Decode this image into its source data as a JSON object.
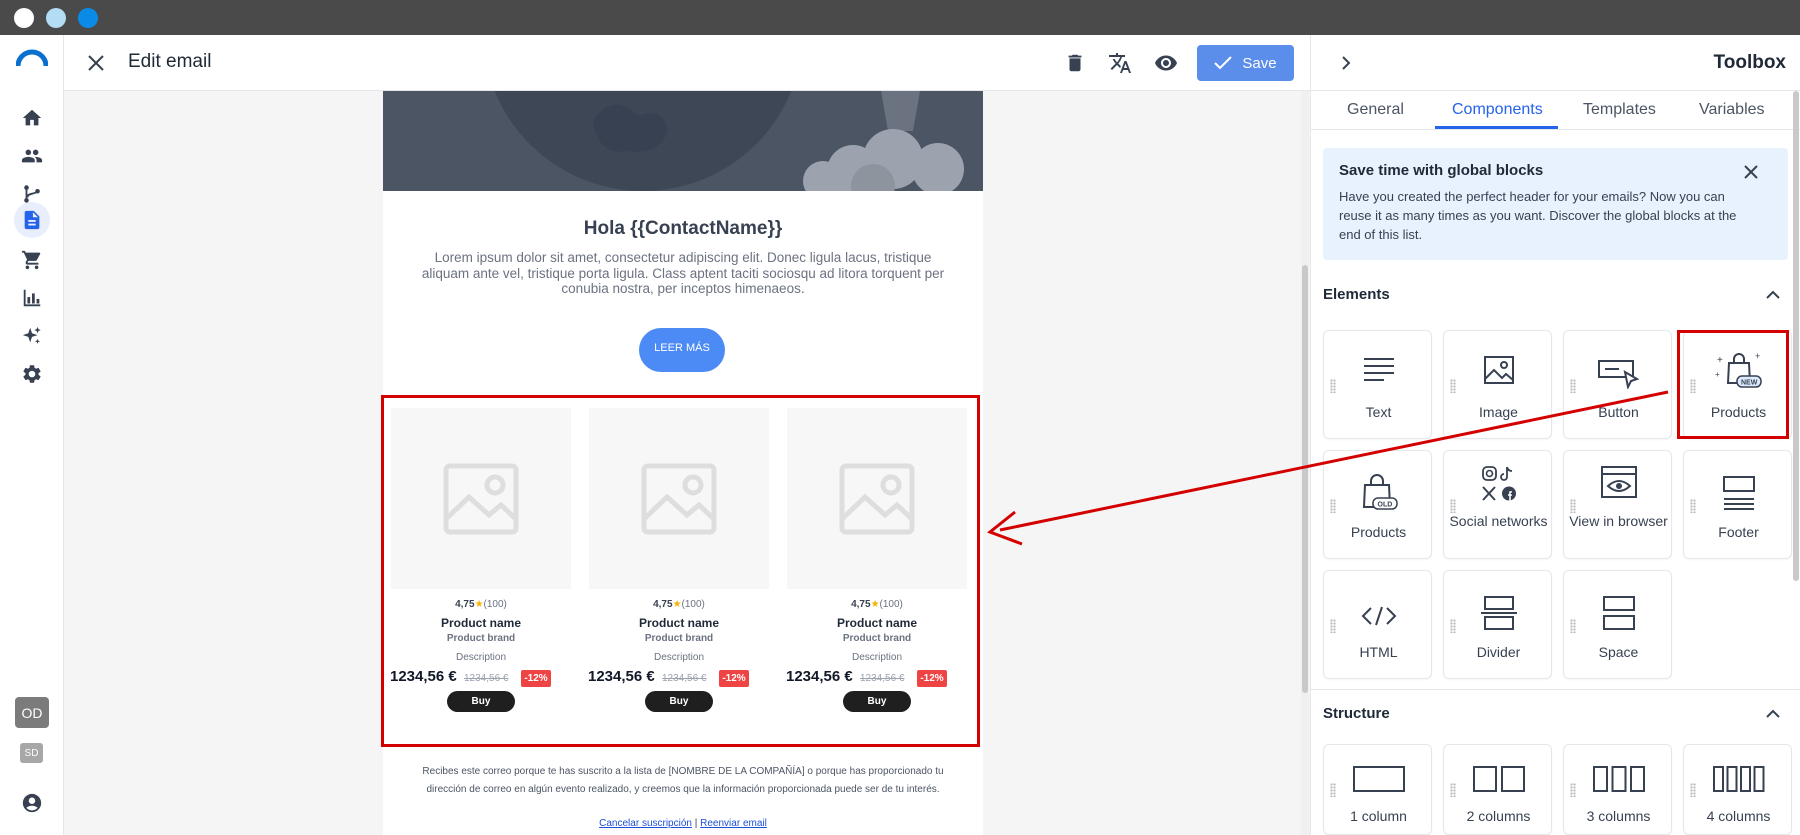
{
  "header": {
    "title": "Edit email",
    "save_label": "Save"
  },
  "email": {
    "greeting": "Hola {{ContactName}}",
    "body": "Lorem ipsum dolor sit amet, consectetur adipiscing elit. Donec ligula lacus, tristique aliquam ante vel, tristique porta ligula. Class aptent taciti sociosqu ad litora torquent per conubia nostra, per inceptos himenaeos.",
    "cta_label": "LEER MÁS",
    "products": [
      {
        "rating": "4,75",
        "reviews": "(100)",
        "name": "Product name",
        "brand": "Product brand",
        "description": "Description",
        "price": "1234,56 €",
        "old_price": "1234,56 €",
        "discount": "-12%",
        "buy": "Buy"
      },
      {
        "rating": "4,75",
        "reviews": "(100)",
        "name": "Product name",
        "brand": "Product brand",
        "description": "Description",
        "price": "1234,56 €",
        "old_price": "1234,56 €",
        "discount": "-12%",
        "buy": "Buy"
      },
      {
        "rating": "4,75",
        "reviews": "(100)",
        "name": "Product name",
        "brand": "Product brand",
        "description": "Description",
        "price": "1234,56 €",
        "old_price": "1234,56 €",
        "discount": "-12%",
        "buy": "Buy"
      }
    ],
    "footer_text": "Recibes este correo porque te has suscrito a la lista de [NOMBRE DE LA COMPAÑÍA] o porque has proporcionado tu dirección de correo en algún evento realizado, y creemos que la información proporcionada puede ser de tu interés.",
    "unsubscribe": "Cancelar suscripción",
    "separator": "|",
    "resend": "Reenviar email"
  },
  "sidebar": {
    "avatar_primary": "OD",
    "avatar_secondary": "SD"
  },
  "toolbox": {
    "title": "Toolbox",
    "tabs": [
      "General",
      "Components",
      "Templates",
      "Variables"
    ],
    "active_tab": "Components",
    "notice": {
      "title": "Save time with global blocks",
      "text": "Have you created the perfect header for your emails? Now you can reuse it as many times as you want. Discover the global blocks at the end of this list."
    },
    "elements_title": "Elements",
    "elements": [
      {
        "label": "Text",
        "icon": "text-icon"
      },
      {
        "label": "Image",
        "icon": "image-icon"
      },
      {
        "label": "Button",
        "icon": "button-icon"
      },
      {
        "label": "Products",
        "icon": "products-new-icon",
        "badge": "NEW"
      },
      {
        "label": "Products",
        "icon": "products-old-icon",
        "badge": "OLD"
      },
      {
        "label": "Social networks",
        "icon": "social-networks-icon"
      },
      {
        "label": "View in browser",
        "icon": "view-in-browser-icon"
      },
      {
        "label": "Footer",
        "icon": "footer-icon"
      },
      {
        "label": "HTML",
        "icon": "html-icon"
      },
      {
        "label": "Divider",
        "icon": "divider-icon"
      },
      {
        "label": "Space",
        "icon": "space-icon"
      }
    ],
    "structure_title": "Structure",
    "structure": [
      {
        "label": "1 column",
        "icon": "one-column-icon"
      },
      {
        "label": "2 columns",
        "icon": "two-columns-icon"
      },
      {
        "label": "3 columns",
        "icon": "three-columns-icon"
      },
      {
        "label": "4 columns",
        "icon": "four-columns-icon"
      }
    ]
  },
  "colors": {
    "accent": "#4a86e8",
    "annotation": "#d40000",
    "discount": "#ef4444"
  }
}
